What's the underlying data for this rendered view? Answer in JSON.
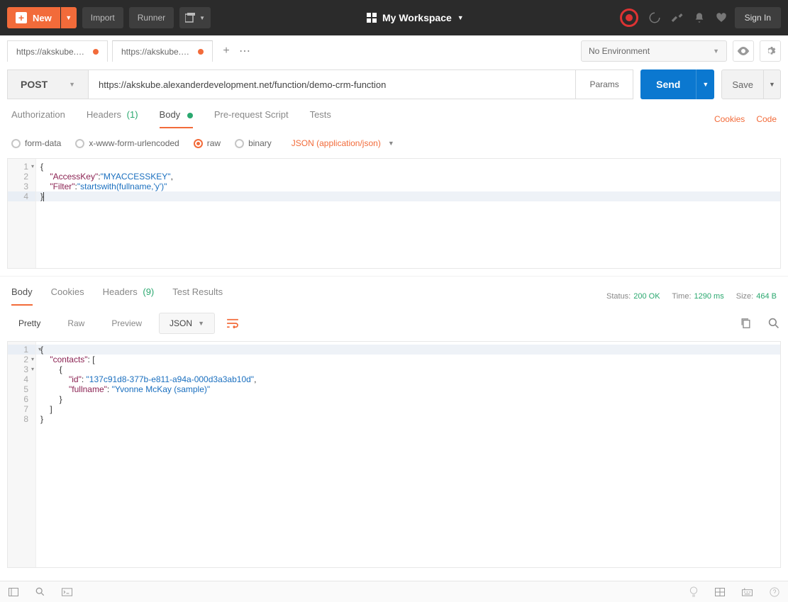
{
  "topbar": {
    "new_label": "New",
    "import_label": "Import",
    "runner_label": "Runner",
    "workspace_label": "My Workspace",
    "signin_label": "Sign In"
  },
  "tabs": {
    "items": [
      {
        "label": "https://akskube.alexa"
      },
      {
        "label": "https://akskube.alexa"
      }
    ]
  },
  "env": {
    "selected": "No Environment"
  },
  "request": {
    "method": "POST",
    "url": "https://akskube.alexanderdevelopment.net/function/demo-crm-function",
    "params_label": "Params",
    "send_label": "Send",
    "save_label": "Save",
    "tabs": {
      "authorization": "Authorization",
      "headers": "Headers",
      "headers_count": "(1)",
      "body": "Body",
      "prerequest": "Pre-request Script",
      "tests": "Tests"
    },
    "links": {
      "cookies": "Cookies",
      "code": "Code"
    },
    "body_types": {
      "form_data": "form-data",
      "urlencoded": "x-www-form-urlencoded",
      "raw": "raw",
      "binary": "binary",
      "content_type": "JSON (application/json)"
    },
    "body_code": {
      "l1": "{",
      "l2a": "    \"AccessKey\"",
      "l2b": ":",
      "l2c": "\"MYACCESSKEY\"",
      "l2d": ",",
      "l3a": "    \"Filter\"",
      "l3b": ":",
      "l3c": "\"startswith(fullname,'y')\"",
      "l4": "}"
    }
  },
  "response": {
    "tabs": {
      "body": "Body",
      "cookies": "Cookies",
      "headers": "Headers",
      "headers_count": "(9)",
      "test_results": "Test Results"
    },
    "meta": {
      "status_label": "Status:",
      "status_value": "200 OK",
      "time_label": "Time:",
      "time_value": "1290 ms",
      "size_label": "Size:",
      "size_value": "464 B"
    },
    "view_modes": {
      "pretty": "Pretty",
      "raw": "Raw",
      "preview": "Preview",
      "format": "JSON"
    },
    "body_code": {
      "l1": "{",
      "l2a": "    \"contacts\"",
      "l2b": ": [",
      "l3": "        {",
      "l4a": "            \"id\"",
      "l4b": ": ",
      "l4c": "\"137c91d8-377b-e811-a94a-000d3a3ab10d\"",
      "l4d": ",",
      "l5a": "            \"fullname\"",
      "l5b": ": ",
      "l5c": "\"Yvonne McKay (sample)\"",
      "l6": "        }",
      "l7": "    ]",
      "l8": "}"
    }
  }
}
